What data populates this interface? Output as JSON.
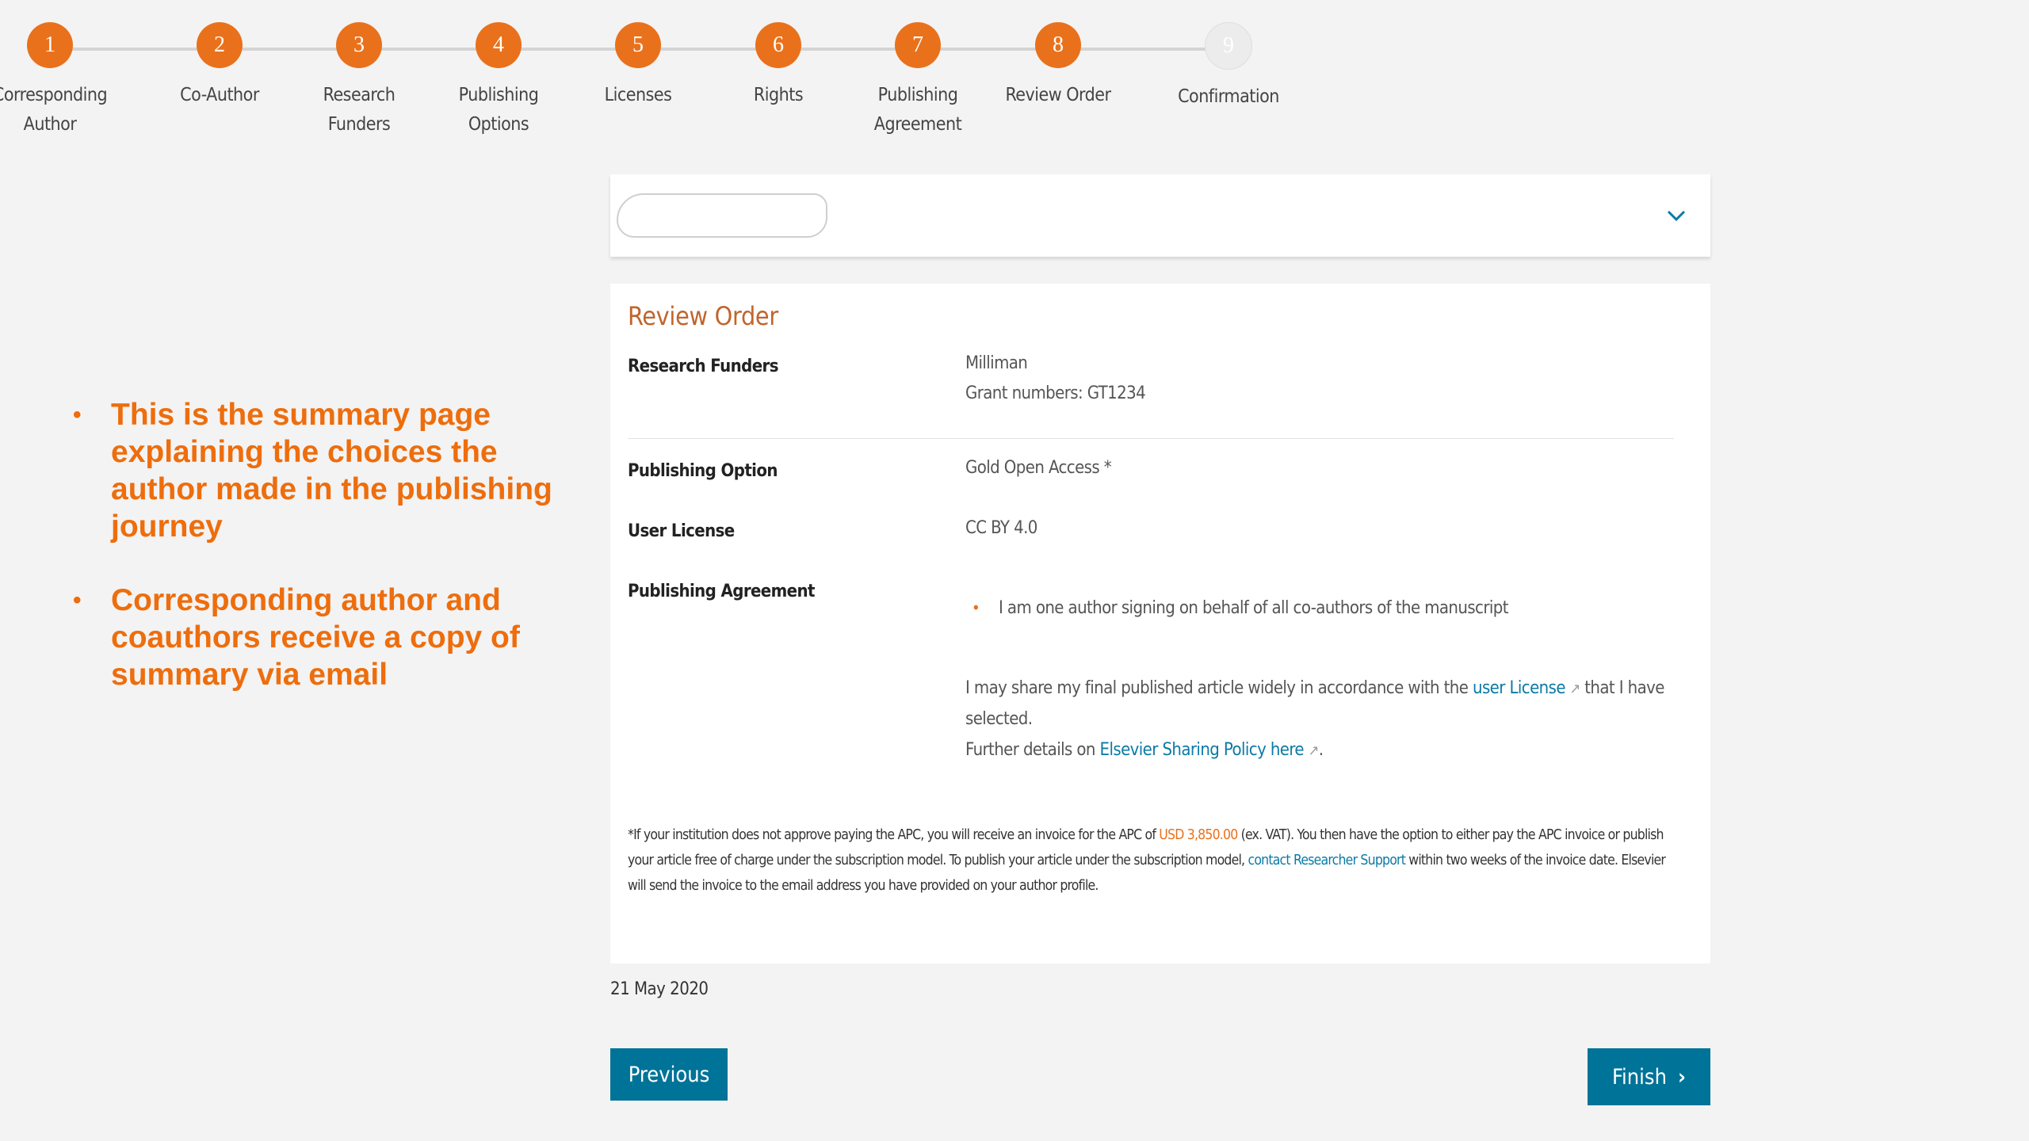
{
  "stepper": {
    "steps": [
      {
        "number": "1",
        "label_line1": "Corresponding",
        "label_line2": "Author",
        "state": "completed"
      },
      {
        "number": "2",
        "label_line1": "Co-Author",
        "label_line2": "",
        "state": "completed"
      },
      {
        "number": "3",
        "label_line1": "Research",
        "label_line2": "Funders",
        "state": "completed"
      },
      {
        "number": "4",
        "label_line1": "Publishing",
        "label_line2": "Options",
        "state": "completed"
      },
      {
        "number": "5",
        "label_line1": "Licenses",
        "label_line2": "",
        "state": "completed"
      },
      {
        "number": "6",
        "label_line1": "Rights",
        "label_line2": "",
        "state": "completed"
      },
      {
        "number": "7",
        "label_line1": "Publishing",
        "label_line2": "Agreement",
        "state": "completed"
      },
      {
        "number": "8",
        "label_line1": "Review Order",
        "label_line2": "",
        "state": "current"
      },
      {
        "number": "9",
        "label_line1": "Confirmation",
        "label_line2": "",
        "state": "inactive"
      }
    ]
  },
  "notes": [
    "This is the summary page explaining the choices the author made in the publishing journey",
    "Corresponding author and coauthors receive a copy of summary via email"
  ],
  "article": {
    "chevron_icon": "chevron-down-icon"
  },
  "review": {
    "title": "Review Order",
    "research_funders": {
      "label": "Research Funders",
      "funder": "Milliman",
      "grant": "Grant numbers: GT1234"
    },
    "publishing_option": {
      "label": "Publishing Option",
      "value": "Gold Open Access *"
    },
    "user_license": {
      "label": "User License",
      "value": "CC BY 4.0"
    },
    "publishing_agreement": {
      "label": "Publishing Agreement",
      "bullet": "I am one author signing on behalf of all co-authors of the manuscript",
      "share_pre": "I may share my final published article widely in accordance with the",
      "share_link": "user License",
      "share_post": "that I have selected.",
      "further_pre": "Further details on",
      "further_link": "Elsevier Sharing Policy here",
      "further_post": "."
    },
    "fineprint": {
      "part1": "*If your institution does not approve paying the APC, you will receive an invoice for the APC of",
      "price": "USD 3,850.00",
      "part2": "(ex. VAT). You then have the option to either pay the APC invoice or publish your article free of charge under the subscription model. To publish your article under the subscription model,",
      "link": "contact Researcher Support",
      "part3": "within two weeks of the invoice date. Elsevier will send the invoice to the email address you have provided on your author profile."
    }
  },
  "footer": {
    "date": "21 May 2020",
    "previous_label": "Previous",
    "finish_label": "Finish",
    "finish_chevron": "›"
  },
  "colors": {
    "accent_orange": "#e9711c",
    "button_blue": "#007398",
    "link_blue": "#0c7aa5"
  }
}
